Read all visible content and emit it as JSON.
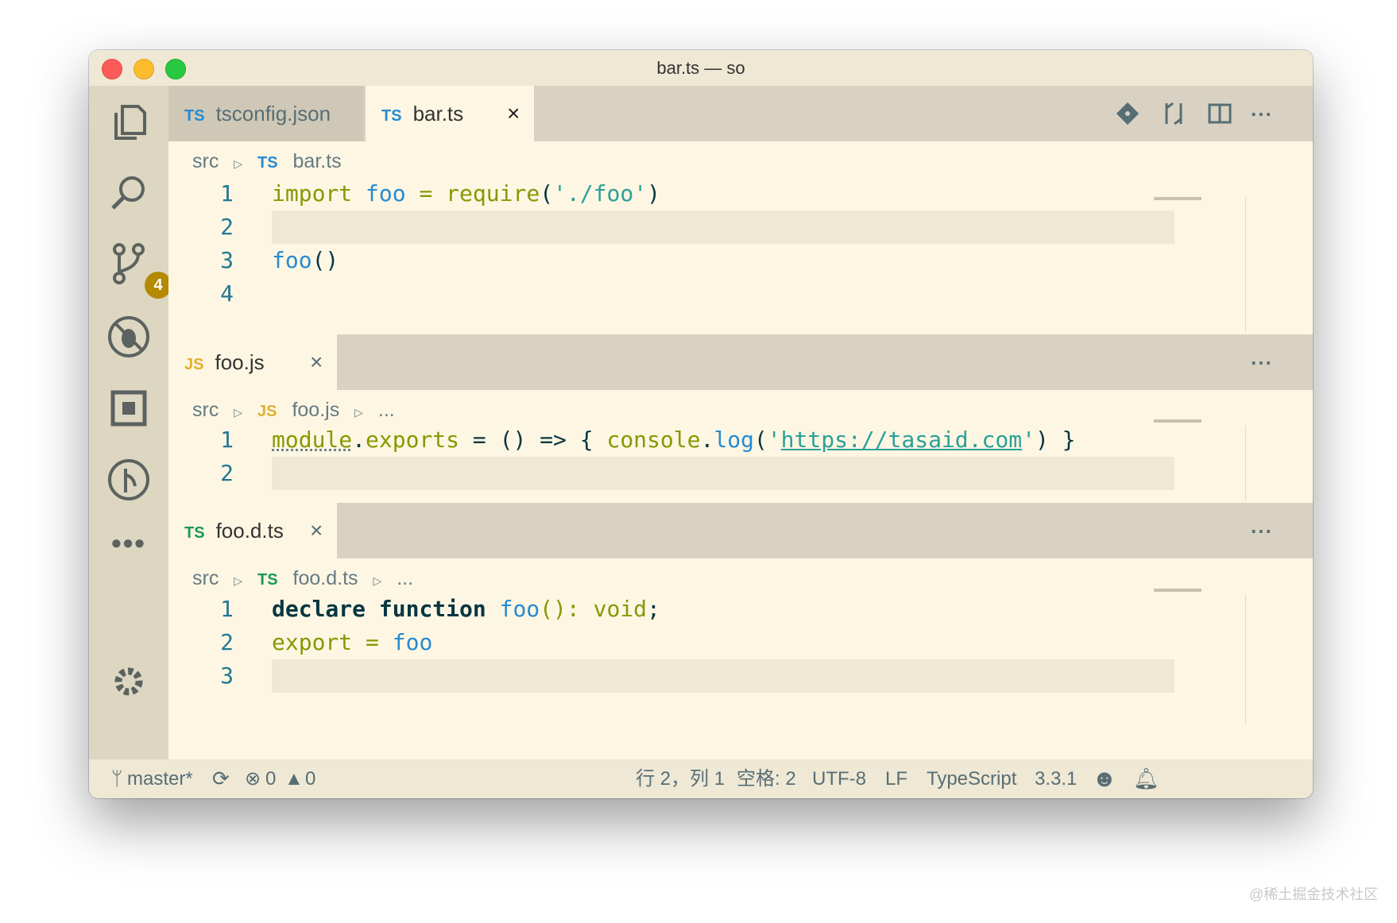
{
  "window": {
    "title": "bar.ts — so"
  },
  "activity_bar": {
    "source_control_badge": "4",
    "items": [
      "explorer-icon",
      "search-icon",
      "source-control-icon",
      "debug-icon",
      "extensions-icon",
      "timeline-icon",
      "more-icon",
      "settings-icon"
    ]
  },
  "group1": {
    "tabs": [
      {
        "lang": "TS",
        "label": "tsconfig.json"
      },
      {
        "lang": "TS",
        "label": "bar.ts",
        "close": "×"
      }
    ],
    "breadcrumb": {
      "folder": "src",
      "lang": "TS",
      "file": "bar.ts"
    },
    "lines": [
      {
        "n": "1",
        "tokens": [
          "import",
          " ",
          "foo",
          " = ",
          "require",
          "(",
          "'./foo'",
          ")"
        ]
      },
      {
        "n": "2"
      },
      {
        "n": "3",
        "tokens": [
          "foo",
          "()"
        ]
      },
      {
        "n": "4"
      }
    ],
    "more": "..."
  },
  "group2": {
    "tab": {
      "lang": "JS",
      "label": "foo.js",
      "close": "×"
    },
    "breadcrumb": {
      "folder": "src",
      "lang": "JS",
      "file": "foo.js",
      "tail": "..."
    },
    "lines": [
      {
        "n": "1",
        "tokens": [
          "module",
          ".",
          "exports",
          " = () => { ",
          "console",
          ".",
          "log",
          "(",
          "'",
          "https://tasaid.com",
          "'",
          ") }"
        ]
      },
      {
        "n": "2"
      }
    ],
    "more": "..."
  },
  "group3": {
    "tab": {
      "lang": "TS",
      "label": "foo.d.ts",
      "close": "×"
    },
    "breadcrumb": {
      "folder": "src",
      "lang": "TS",
      "file": "foo.d.ts",
      "tail": "..."
    },
    "lines": [
      {
        "n": "1",
        "tokens": [
          "declare",
          " ",
          "function",
          " ",
          "foo",
          "(): ",
          "void",
          ";"
        ]
      },
      {
        "n": "2",
        "tokens": [
          "export",
          " = ",
          "foo"
        ]
      },
      {
        "n": "3"
      }
    ],
    "more": "..."
  },
  "statusbar": {
    "branch": "master*",
    "errors": "0",
    "warnings": "0",
    "position": "行 2，列 1",
    "spaces": "空格: 2",
    "encoding": "UTF-8",
    "eol": "LF",
    "language": "TypeScript",
    "version": "3.3.1"
  },
  "watermark": "@稀土掘金技术社区",
  "colors": {
    "accent": "#268bd2",
    "badge": "#b58900",
    "bg": "#fdf6e3",
    "tabbar": "#d9d2c2"
  }
}
